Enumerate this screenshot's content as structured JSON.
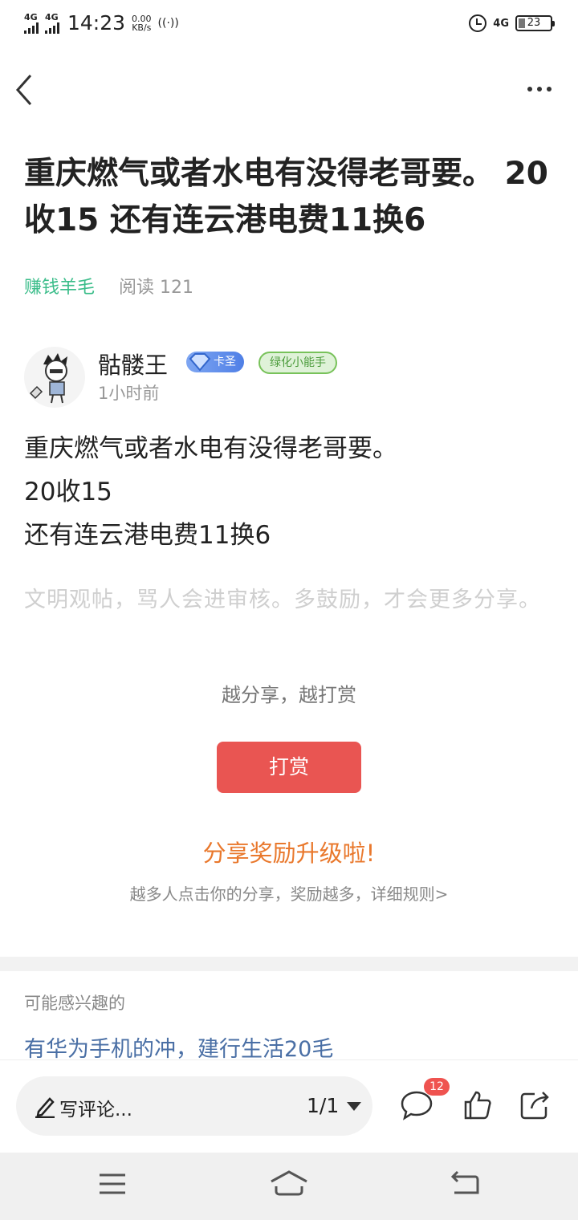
{
  "status_bar": {
    "signal1": "4G",
    "signal2": "4G",
    "time": "14:23",
    "speed_value": "0.00",
    "speed_unit": "KB/s",
    "hotspot": "((·))",
    "net_type": "4G",
    "battery": "23",
    "icons": [
      "signal-icon",
      "hotspot-icon",
      "alarm-icon",
      "battery-icon"
    ]
  },
  "nav": {
    "back_icon": "chevron-left-icon",
    "more_icon": "more-icon"
  },
  "article": {
    "title": "重庆燃气或者水电有没得老哥要。 20收15 还有连云港电费11换6",
    "category": "赚钱羊毛",
    "reads": "阅读 121",
    "author": {
      "name": "骷髅王",
      "badge_vip": "卡圣",
      "badge_green": "绿化小能手",
      "time": "1小时前"
    },
    "content": [
      "重庆燃气或者水电有没得老哥要。",
      "20收15",
      "还有连云港电费11换6"
    ],
    "notice": "文明观帖，骂人会进审核。多鼓励，才会更多分享。"
  },
  "tip": {
    "label": "越分享，越打赏",
    "button": "打赏",
    "color": "#e95552"
  },
  "share": {
    "title": "分享奖励升级啦!",
    "desc": "越多人点击你的分享，奖励越多，详细规则>",
    "color": "#e9782c"
  },
  "recommend": {
    "header": "可能感兴趣的",
    "items": [
      "有华为手机的冲，建行生活20毛"
    ]
  },
  "action_bar": {
    "comment_placeholder": "写评论...",
    "page_indicator": "1/1",
    "comment_count": "12",
    "icons": [
      "pencil-icon",
      "comment-icon",
      "thumbs-up-icon",
      "share-icon"
    ]
  },
  "system_nav": {
    "icons": [
      "menu-icon",
      "home-icon",
      "back-icon"
    ]
  }
}
